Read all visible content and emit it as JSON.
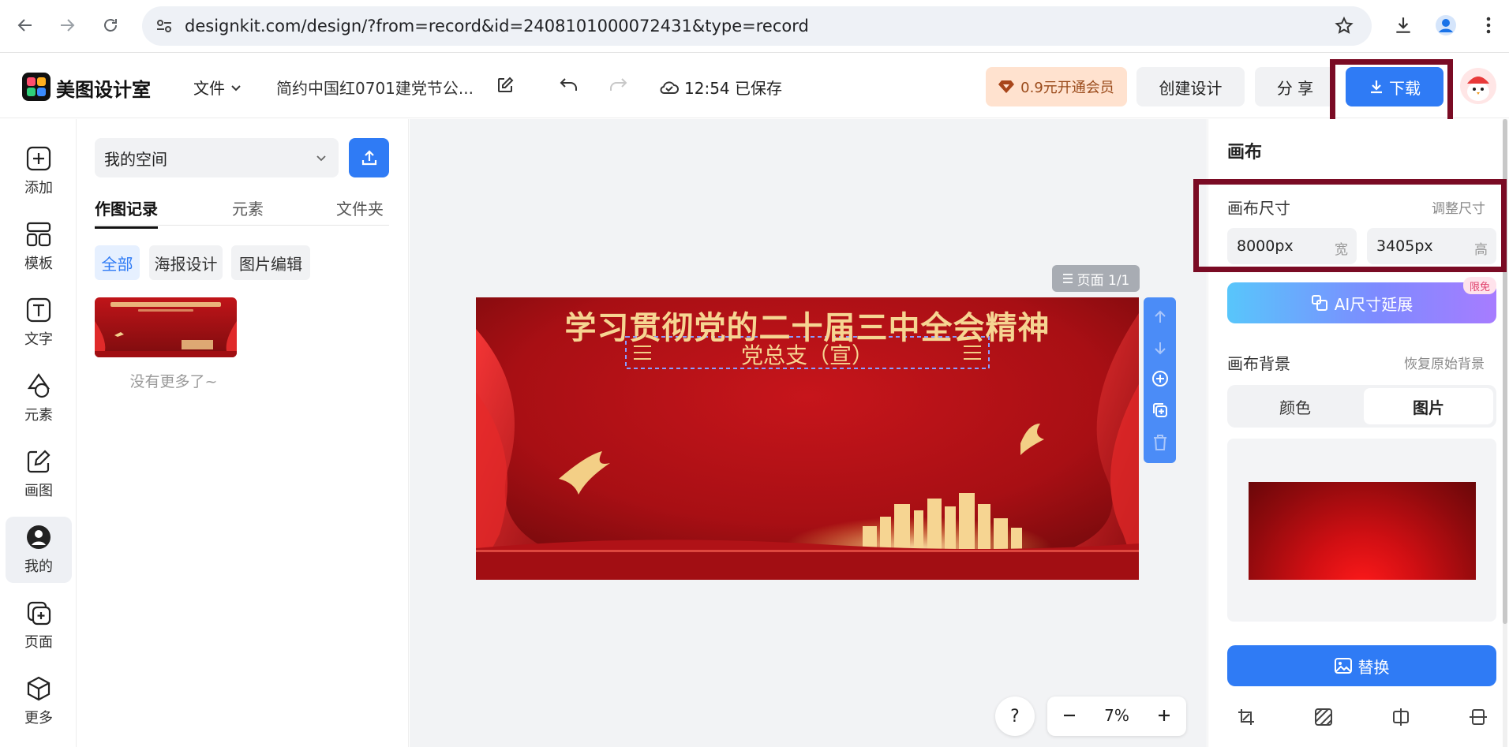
{
  "browser": {
    "url": "designkit.com/design/?from=record&id=2408101000072431&type=record"
  },
  "header": {
    "logo_text": "美图设计室",
    "file_menu": "文件",
    "doc_title": "简约中国红0701建党节公...",
    "save_status": "12:54 已保存",
    "vip_label": "0.9元开通会员",
    "create_label": "创建设计",
    "share_label": "分 享",
    "download_label": "下载"
  },
  "rail": {
    "items": [
      {
        "label": "添加",
        "icon": "plus-square-icon"
      },
      {
        "label": "模板",
        "icon": "template-icon"
      },
      {
        "label": "文字",
        "icon": "text-icon"
      },
      {
        "label": "元素",
        "icon": "shapes-icon"
      },
      {
        "label": "画图",
        "icon": "draw-icon"
      },
      {
        "label": "我的",
        "icon": "user-icon"
      },
      {
        "label": "页面",
        "icon": "page-icon"
      },
      {
        "label": "更多",
        "icon": "cube-icon"
      }
    ]
  },
  "panel": {
    "space_select": "我的空间",
    "tabs": [
      "作图记录",
      "元素",
      "文件夹"
    ],
    "filters": [
      "全部",
      "海报设计",
      "图片编辑"
    ],
    "no_more": "没有更多了~"
  },
  "canvas": {
    "page_label": "页面 1/1",
    "banner_title": "学习贯彻党的二十届三中全会精神",
    "banner_subtitle": "党总支（宣）",
    "help": "?",
    "zoom": "7%"
  },
  "right": {
    "title": "画布",
    "size_label": "画布尺寸",
    "adjust_size": "调整尺寸",
    "width_value": "8000px",
    "width_unit": "宽",
    "height_value": "3405px",
    "height_unit": "高",
    "ai_extend": "AI尺寸延展",
    "limited_badge": "限免",
    "bg_label": "画布背景",
    "restore_bg": "恢复原始背景",
    "bg_tabs": [
      "颜色",
      "图片"
    ],
    "replace": "替换"
  },
  "colors": {
    "primary": "#2f7bf5",
    "highlight_box": "#7a0b24",
    "banner_red": "#b3121a",
    "gold": "#f4d28a",
    "vip_bg": "#ffe2cf"
  }
}
